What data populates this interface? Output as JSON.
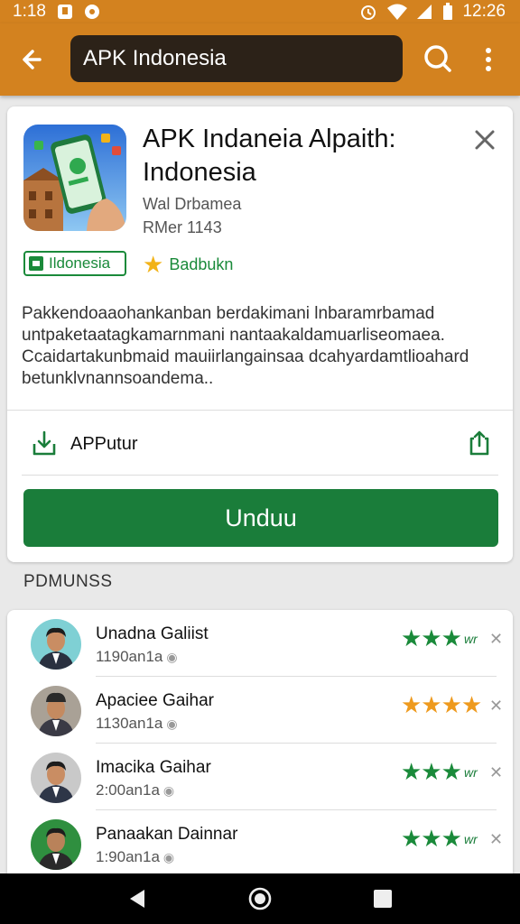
{
  "status_bar": {
    "time_left": "1:18",
    "time_right": "12:26"
  },
  "search": {
    "query": "APK Indonesia"
  },
  "app": {
    "title": "APK Indaneia Alpaith: Indonesia",
    "developer": "Wal Drbamea",
    "size": "RMer 1143",
    "category_badge": "Ildonesia",
    "rating_badge": "Badbukn",
    "description": "Pakkendoaaohankanban berdakimani lnbaramrbamad untpaketaatagkamarnmani nantaakaldamuarliseomaea. Ccaidartakunbmaid mauiirlangainsaa dcahyardamtlioahard betunklvnannsoandema..",
    "install_label": "APPutur",
    "download_label": "Unduu"
  },
  "section_label": "PDMUNSS",
  "reviews": [
    {
      "name": "Unadna Galiist",
      "time": "1190an1a",
      "stars": "★★★",
      "tag": "wr",
      "stars_color": "#1a8a3a",
      "bg": "#7fd0d4",
      "jacket": "#2a3140"
    },
    {
      "name": "Apaciee Gaihar",
      "time": "1130an1a",
      "stars": "★★★★",
      "tag": "",
      "stars_color": "#ee9a1e",
      "bg": "#a9a196",
      "jacket": "#3a3a45"
    },
    {
      "name": "Imacika Gaihar",
      "time": "2:00an1a",
      "stars": "★★★",
      "tag": "wr",
      "stars_color": "#1a8a3a",
      "bg": "#c9c9c9",
      "jacket": "#2e3648"
    },
    {
      "name": "Panaakan Dainnar",
      "time": "1:90an1a",
      "stars": "★★★",
      "tag": "wr",
      "stars_color": "#1a8a3a",
      "bg": "#2f8f3f",
      "jacket": "#2a2a2a"
    }
  ],
  "colors": {
    "appbar": "#d3821f",
    "accent_green": "#1a7d3a",
    "star_gold": "#f2b318"
  },
  "icons": [
    "back-arrow-icon",
    "search-icon",
    "more-vert-icon",
    "close-icon",
    "install-icon",
    "share-icon",
    "star-icon",
    "nav-back-icon",
    "nav-home-icon",
    "nav-recent-icon"
  ]
}
